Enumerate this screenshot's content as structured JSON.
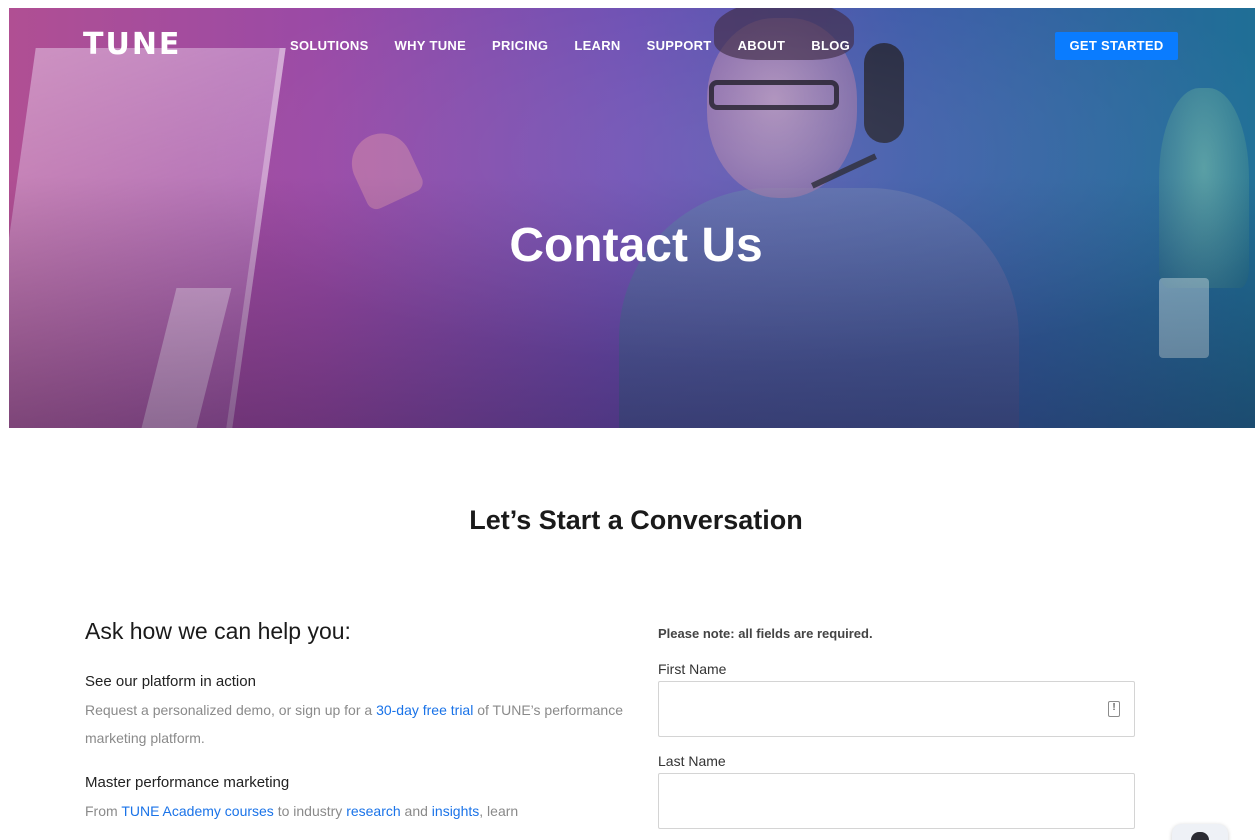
{
  "nav": {
    "logo": "TUNE",
    "links": [
      "SOLUTIONS",
      "WHY TUNE",
      "PRICING",
      "LEARN",
      "SUPPORT",
      "ABOUT",
      "BLOG"
    ],
    "cta": "GET STARTED"
  },
  "hero": {
    "title": "Contact Us"
  },
  "section": {
    "title": "Let’s Start a Conversation"
  },
  "left": {
    "heading": "Ask how we can help you:",
    "items": [
      {
        "title": "See our platform in action",
        "text_before": "Request a personalized demo, or sign up for a ",
        "link1": "30-day free trial",
        "text_after": " of TUNE’s performance marketing platform."
      },
      {
        "title": "Master performance marketing",
        "text_before": "From ",
        "link1": "TUNE Academy courses",
        "text_mid1": " to industry ",
        "link2": "research",
        "text_mid2": " and ",
        "link3": "insights",
        "text_after": ", learn"
      }
    ]
  },
  "form": {
    "note": "Please note: all fields are required.",
    "fields": [
      {
        "label": "First Name",
        "value": ""
      },
      {
        "label": "Last Name",
        "value": ""
      }
    ]
  },
  "colors": {
    "accent": "#0a7cff",
    "link": "#1a73e8"
  },
  "icons": {
    "autofill": "contact-card-icon",
    "chat": "chat-avatar-icon"
  }
}
